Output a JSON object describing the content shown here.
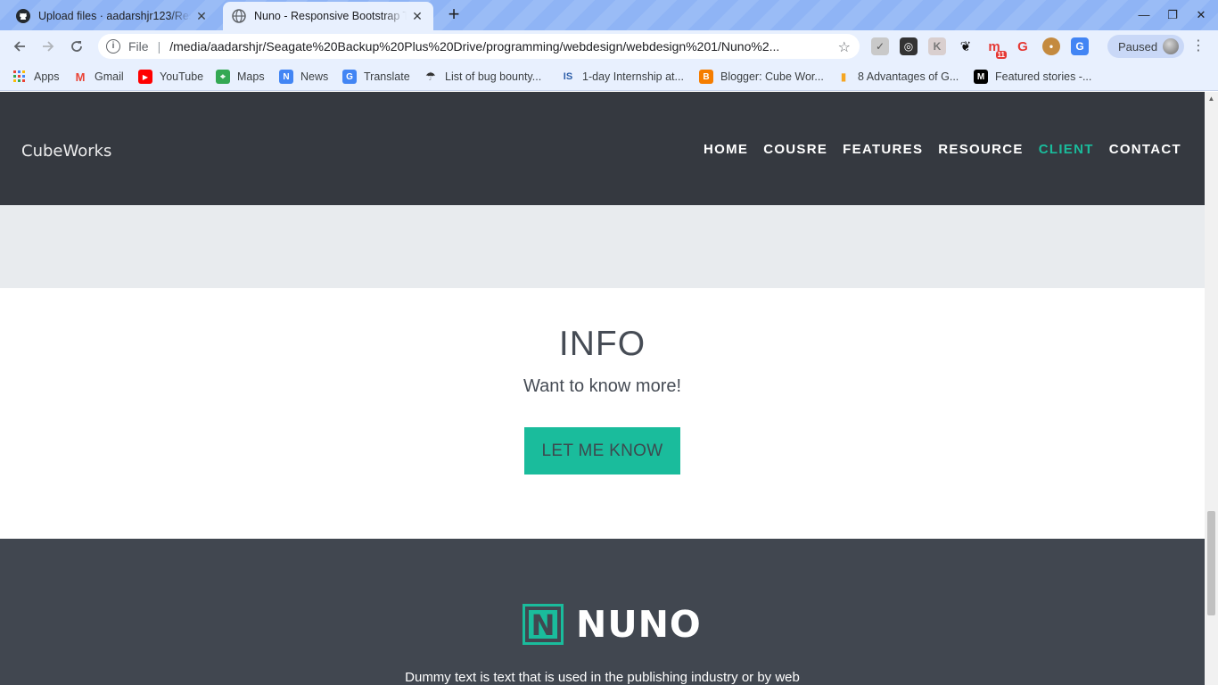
{
  "tabs": [
    {
      "title": "Upload files · aadarshjr123/Res",
      "icon": "github-icon"
    },
    {
      "title": "Nuno - Responsive Bootstrap T",
      "icon": "globe-icon"
    }
  ],
  "toolbar": {
    "scheme": "File",
    "url": "/media/aadarshjr/Seagate%20Backup%20Plus%20Drive/programming/webdesign/webdesign%201/Nuno%2...",
    "profile_label": "Paused",
    "extension_badge": "11"
  },
  "bookmarks": [
    {
      "label": "Apps",
      "icon": "apps-grid-icon"
    },
    {
      "label": "Gmail",
      "icon": "gmail-icon"
    },
    {
      "label": "YouTube",
      "icon": "youtube-icon"
    },
    {
      "label": "Maps",
      "icon": "maps-icon"
    },
    {
      "label": "News",
      "icon": "news-icon"
    },
    {
      "label": "Translate",
      "icon": "translate-icon"
    },
    {
      "label": "List of bug bounty...",
      "icon": "bug-icon"
    },
    {
      "label": "1-day Internship at...",
      "icon": "is-icon"
    },
    {
      "label": "Blogger: Cube Wor...",
      "icon": "blogger-icon"
    },
    {
      "label": "8 Advantages of G...",
      "icon": "chart-icon"
    },
    {
      "label": "Featured stories -...",
      "icon": "medium-icon"
    }
  ],
  "site": {
    "brand": "CubeWorks",
    "nav": [
      "HOME",
      "COUSRE",
      "FEATURES",
      "RESOURCE",
      "CLIENT",
      "CONTACT"
    ],
    "active_nav": "CLIENT",
    "info": {
      "title": "INFO",
      "subtitle": "Want to know more!",
      "button": "LET ME KNOW"
    },
    "footer": {
      "logo_letter": "N",
      "logo_word": "NUNO",
      "text": "Dummy text is text that is used in the publishing industry or by web"
    }
  },
  "colors": {
    "accent": "#1abc9c",
    "nav_bg": "#353940",
    "footer_bg": "#414750",
    "band_bg": "#e8ebee"
  }
}
